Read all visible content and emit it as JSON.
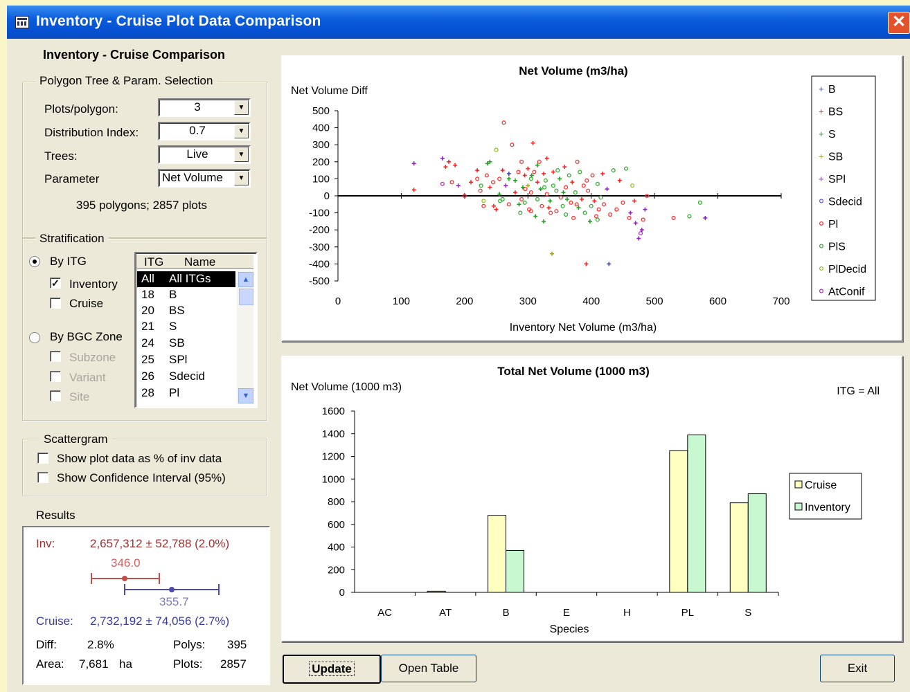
{
  "window": {
    "title": "Inventory - Cruise Plot Data Comparison",
    "close_label": "✕"
  },
  "left": {
    "heading": "Inventory - Cruise Comparison",
    "polygon_group": "Polygon Tree & Param. Selection",
    "fields": [
      {
        "label": "Plots/polygon:",
        "value": "3"
      },
      {
        "label": "Distribution Index:",
        "value": "0.7"
      },
      {
        "label": "Trees:",
        "value": "Live"
      },
      {
        "label": "Parameter",
        "value": "Net Volume"
      }
    ],
    "summary": "395 polygons; 2857 plots",
    "strat_group": "Stratification",
    "by_itg": "By ITG",
    "inventory": "Inventory",
    "cruise": "Cruise",
    "by_bgc": "By BGC Zone",
    "subzone": "Subzone",
    "variant": "Variant",
    "site": "Site",
    "list_head": {
      "itg": "ITG",
      "name": "Name"
    },
    "list_rows": [
      {
        "itg": "All",
        "name": "All ITGs"
      },
      {
        "itg": "18",
        "name": "B"
      },
      {
        "itg": "20",
        "name": "BS"
      },
      {
        "itg": "21",
        "name": "S"
      },
      {
        "itg": "24",
        "name": "SB"
      },
      {
        "itg": "25",
        "name": "SPl"
      },
      {
        "itg": "26",
        "name": "Sdecid"
      },
      {
        "itg": "28",
        "name": "Pl"
      }
    ],
    "scatter_group": "Scattergram",
    "show_pct": "Show plot data as % of inv data",
    "show_ci": "Show Confidence Interval (95%)",
    "results_label": "Results",
    "results": {
      "inv_label": "Inv:",
      "inv_value": "2,657,312  ±  52,788  (2.0%)",
      "inv_mean": "346.0",
      "cruise_mean": "355.7",
      "cruise_label": "Cruise:",
      "cruise_value": "2,732,192  ±  74,056  (2.7%)",
      "diff_label": "Diff:",
      "diff_value": "2.8%",
      "polys_label": "Polys:",
      "polys_value": "395",
      "area_label": "Area:",
      "area_value": "7,681",
      "area_unit": "ha",
      "plots_label": "Plots:",
      "plots_value": "2857"
    },
    "colors": {
      "inv": "#c0504d",
      "cruise": "#4a4aa8"
    }
  },
  "buttons": {
    "update": "Update",
    "open_table": "Open Table",
    "exit": "Exit"
  },
  "chart_data": [
    {
      "type": "scatter",
      "title": "Net Volume (m3/ha)",
      "ylabel": "Net Volume Diff",
      "xlabel": "Inventory Net Volume (m3/ha)",
      "xlim": [
        0,
        700
      ],
      "ylim": [
        -500,
        500
      ],
      "xticks": [
        "0",
        "100",
        "200",
        "300",
        "400",
        "500",
        "600",
        "700"
      ],
      "yticks": [
        "500",
        "400",
        "300",
        "200",
        "100",
        "0",
        "-100",
        "-200",
        "-300",
        "-400",
        "-500"
      ],
      "legend_position": "right",
      "series": [
        {
          "name": "B",
          "color": "#4040c0",
          "marker": "+"
        },
        {
          "name": "BS",
          "color": "#ff2020",
          "marker": "+"
        },
        {
          "name": "S",
          "color": "#20a020",
          "marker": "+"
        },
        {
          "name": "SB",
          "color": "#a0a020",
          "marker": "+"
        },
        {
          "name": "SPl",
          "color": "#9020c0",
          "marker": "+"
        },
        {
          "name": "Sdecid",
          "color": "#6060d0",
          "marker": "o"
        },
        {
          "name": "Pl",
          "color": "#ff3030",
          "marker": "o"
        },
        {
          "name": "PlS",
          "color": "#30b030",
          "marker": "o"
        },
        {
          "name": "PlDecid",
          "color": "#90c030",
          "marker": "o"
        },
        {
          "name": "AtConif",
          "color": "#b030c0",
          "marker": "o"
        }
      ],
      "points": [
        [
          120,
          190,
          4
        ],
        [
          120,
          35,
          1
        ],
        [
          165,
          220,
          4
        ],
        [
          170,
          170,
          1
        ],
        [
          175,
          200,
          1
        ],
        [
          185,
          180,
          1
        ],
        [
          190,
          60,
          4
        ],
        [
          180,
          80,
          6
        ],
        [
          165,
          70,
          9
        ],
        [
          200,
          0,
          6
        ],
        [
          210,
          80,
          1
        ],
        [
          220,
          100,
          6
        ],
        [
          220,
          150,
          1
        ],
        [
          225,
          30,
          6
        ],
        [
          230,
          -30,
          8
        ],
        [
          230,
          -60,
          6
        ],
        [
          235,
          120,
          6
        ],
        [
          240,
          50,
          1
        ],
        [
          240,
          200,
          2
        ],
        [
          245,
          80,
          6
        ],
        [
          250,
          270,
          8
        ],
        [
          250,
          -80,
          1
        ],
        [
          255,
          100,
          6
        ],
        [
          255,
          10,
          2
        ],
        [
          260,
          150,
          1
        ],
        [
          260,
          -20,
          7
        ],
        [
          262,
          430,
          6
        ],
        [
          265,
          60,
          4
        ],
        [
          270,
          130,
          0
        ],
        [
          270,
          -50,
          6
        ],
        [
          275,
          300,
          6
        ],
        [
          280,
          20,
          1
        ],
        [
          280,
          90,
          2
        ],
        [
          285,
          140,
          6
        ],
        [
          288,
          -100,
          7
        ],
        [
          290,
          200,
          6
        ],
        [
          292,
          50,
          2
        ],
        [
          295,
          120,
          1
        ],
        [
          295,
          -40,
          7
        ],
        [
          300,
          60,
          3
        ],
        [
          300,
          160,
          1
        ],
        [
          302,
          -80,
          6
        ],
        [
          305,
          100,
          7
        ],
        [
          305,
          20,
          6
        ],
        [
          308,
          310,
          1
        ],
        [
          310,
          140,
          6
        ],
        [
          312,
          -120,
          2
        ],
        [
          315,
          80,
          1
        ],
        [
          315,
          -20,
          7
        ],
        [
          318,
          200,
          6
        ],
        [
          320,
          40,
          2
        ],
        [
          322,
          -60,
          6
        ],
        [
          325,
          130,
          1
        ],
        [
          325,
          -150,
          2
        ],
        [
          328,
          90,
          7
        ],
        [
          330,
          10,
          6
        ],
        [
          330,
          220,
          1
        ],
        [
          335,
          -30,
          2
        ],
        [
          338,
          -340,
          3
        ],
        [
          340,
          60,
          7
        ],
        [
          340,
          140,
          1
        ],
        [
          345,
          -90,
          6
        ],
        [
          345,
          30,
          7
        ],
        [
          350,
          100,
          2
        ],
        [
          352,
          -10,
          6
        ],
        [
          355,
          -60,
          7
        ],
        [
          358,
          170,
          1
        ],
        [
          360,
          50,
          6
        ],
        [
          360,
          -110,
          7
        ],
        [
          365,
          120,
          7
        ],
        [
          368,
          -40,
          6
        ],
        [
          370,
          80,
          1
        ],
        [
          372,
          -130,
          6
        ],
        [
          375,
          20,
          7
        ],
        [
          378,
          200,
          6
        ],
        [
          380,
          -70,
          2
        ],
        [
          382,
          140,
          7
        ],
        [
          385,
          -20,
          1
        ],
        [
          388,
          60,
          6
        ],
        [
          390,
          -100,
          7
        ],
        [
          392,
          -400,
          1
        ],
        [
          395,
          30,
          6
        ],
        [
          398,
          -150,
          2
        ],
        [
          400,
          -60,
          7
        ],
        [
          402,
          120,
          6
        ],
        [
          405,
          -30,
          1
        ],
        [
          408,
          -120,
          6
        ],
        [
          410,
          70,
          7
        ],
        [
          412,
          -80,
          6
        ],
        [
          415,
          -10,
          7
        ],
        [
          418,
          130,
          1
        ],
        [
          420,
          -50,
          6
        ],
        [
          425,
          40,
          4
        ],
        [
          428,
          -400,
          0
        ],
        [
          430,
          -110,
          6
        ],
        [
          435,
          150,
          7
        ],
        [
          440,
          -80,
          6
        ],
        [
          445,
          90,
          1
        ],
        [
          450,
          -40,
          6
        ],
        [
          455,
          160,
          7
        ],
        [
          460,
          -130,
          6
        ],
        [
          462,
          -100,
          4
        ],
        [
          465,
          60,
          8
        ],
        [
          468,
          -30,
          1
        ],
        [
          470,
          -160,
          4
        ],
        [
          475,
          -250,
          4
        ],
        [
          478,
          -220,
          9
        ],
        [
          480,
          -200,
          4
        ],
        [
          482,
          -140,
          6
        ],
        [
          485,
          -80,
          4
        ],
        [
          488,
          0,
          6
        ],
        [
          530,
          -130,
          6
        ],
        [
          555,
          -120,
          7
        ],
        [
          572,
          -40,
          7
        ],
        [
          580,
          -130,
          4
        ],
        [
          270,
          100,
          2
        ],
        [
          290,
          -20,
          6
        ],
        [
          305,
          -90,
          6
        ],
        [
          315,
          180,
          2
        ],
        [
          333,
          -70,
          1
        ],
        [
          347,
          150,
          7
        ],
        [
          362,
          -20,
          2
        ],
        [
          377,
          -50,
          6
        ],
        [
          393,
          90,
          6
        ],
        [
          410,
          -140,
          7
        ],
        [
          256,
          -30,
          7
        ],
        [
          246,
          -60,
          1
        ],
        [
          236,
          190,
          2
        ],
        [
          226,
          60,
          7
        ],
        [
          286,
          -50,
          2
        ],
        [
          296,
          40,
          6
        ],
        [
          306,
          120,
          2
        ],
        [
          326,
          50,
          7
        ],
        [
          336,
          -100,
          6
        ],
        [
          356,
          20,
          2
        ]
      ]
    },
    {
      "type": "bar",
      "title": "Total Net Volume (1000 m3)",
      "ylabel": "Net Volume (1000 m3)",
      "xlabel": "Species",
      "annotation": "ITG = All",
      "categories": [
        "AC",
        "AT",
        "B",
        "E",
        "H",
        "PL",
        "S"
      ],
      "ylim": [
        0,
        1600
      ],
      "yticks": [
        "1600",
        "1400",
        "1200",
        "1000",
        "800",
        "600",
        "400",
        "200",
        "0"
      ],
      "legend_position": "right",
      "series": [
        {
          "name": "Cruise",
          "color": "#ffffc0",
          "values": [
            0,
            10,
            680,
            0,
            0,
            1250,
            790
          ]
        },
        {
          "name": "Inventory",
          "color": "#c8f8d0",
          "values": [
            0,
            0,
            370,
            0,
            0,
            1390,
            870
          ]
        }
      ]
    }
  ]
}
